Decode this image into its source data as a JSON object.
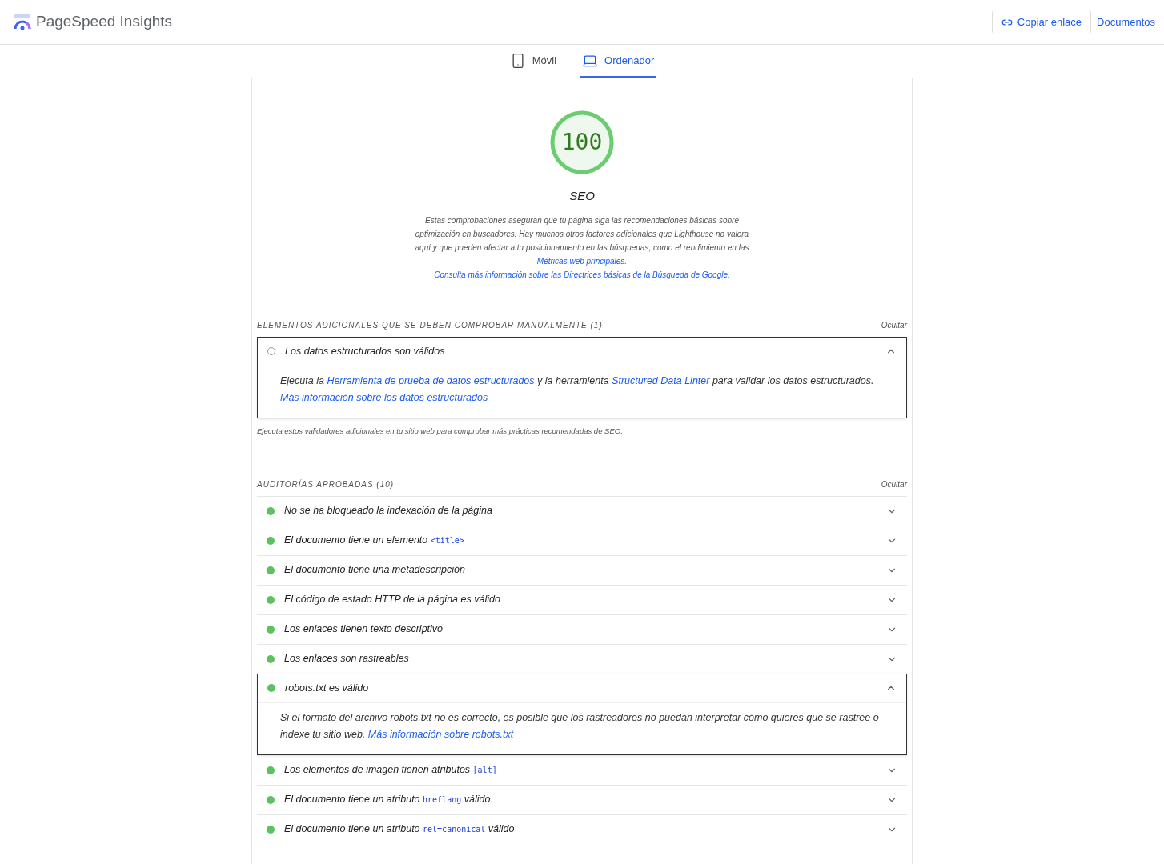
{
  "header": {
    "title": "PageSpeed Insights",
    "copy_button": "Copiar enlace",
    "docs_link": "Documentos"
  },
  "tabs": [
    {
      "label": "Móvil",
      "kind": "phone",
      "selected": false
    },
    {
      "label": "Ordenador",
      "kind": "laptop",
      "selected": true
    }
  ],
  "score": {
    "value": "100",
    "level": 1,
    "category": "SEO",
    "description": [
      {
        "kind": "text",
        "text": "Estas comprobaciones aseguran que tu página siga las recomendaciones básicas sobre optimización en buscadores. Hay muchos otros factores adicionales que Lighthouse no valora aquí y que pueden afectar a tu posicionamiento en las búsquedas, como el rendimiento en las "
      },
      {
        "kind": "link",
        "text": "Métricas web principales"
      },
      {
        "kind": "text",
        "text": ". "
      },
      {
        "kind": "link",
        "text": "Consulta más información sobre las Directrices básicas de la Búsqueda de Google"
      },
      {
        "kind": "text",
        "text": "."
      }
    ]
  },
  "sections": [
    {
      "title": "ELEMENTOS ADICIONALES QUE SE DEBEN COMPROBAR MANUALMENTE (1)",
      "toggle": "Ocultar",
      "audits": [
        {
          "kind": "manual",
          "expanded": true,
          "title": [
            {
              "kind": "text",
              "text": "Los datos estructurados son válidos"
            }
          ],
          "body": [
            {
              "kind": "text",
              "text": "Ejecuta la "
            },
            {
              "kind": "link",
              "text": "Herramienta de prueba de datos estructurados"
            },
            {
              "kind": "text",
              "text": " y la herramienta "
            },
            {
              "kind": "link",
              "text": "Structured Data Linter"
            },
            {
              "kind": "text",
              "text": " para validar los datos estructurados. "
            },
            {
              "kind": "link",
              "text": "Más información sobre los datos estructurados"
            }
          ]
        }
      ],
      "note": "Ejecuta estos validadores adicionales en tu sitio web para comprobar más prácticas recomendadas de SEO."
    },
    {
      "title": "AUDITORÍAS APROBADAS (10)",
      "toggle": "Ocultar",
      "audits": [
        {
          "kind": "pass",
          "expanded": false,
          "title": [
            {
              "kind": "text",
              "text": "No se ha bloqueado la indexación de la página"
            }
          ]
        },
        {
          "kind": "pass",
          "expanded": false,
          "title": [
            {
              "kind": "text",
              "text": "El documento tiene un elemento "
            },
            {
              "kind": "code",
              "text": "<title>"
            }
          ]
        },
        {
          "kind": "pass",
          "expanded": false,
          "title": [
            {
              "kind": "text",
              "text": "El documento tiene una metadescripción"
            }
          ]
        },
        {
          "kind": "pass",
          "expanded": false,
          "title": [
            {
              "kind": "text",
              "text": "El código de estado HTTP de la página es válido"
            }
          ]
        },
        {
          "kind": "pass",
          "expanded": false,
          "title": [
            {
              "kind": "text",
              "text": "Los enlaces tienen texto descriptivo"
            }
          ]
        },
        {
          "kind": "pass",
          "expanded": false,
          "title": [
            {
              "kind": "text",
              "text": "Los enlaces son rastreables"
            }
          ]
        },
        {
          "kind": "pass",
          "expanded": true,
          "title": [
            {
              "kind": "text",
              "text": "robots.txt es válido"
            }
          ],
          "body": [
            {
              "kind": "text",
              "text": "Si el formato del archivo robots.txt no es correcto, es posible que los rastreadores no puedan interpretar cómo quieres que se rastree o indexe tu sitio web. "
            },
            {
              "kind": "link",
              "text": "Más información sobre robots.txt"
            }
          ]
        },
        {
          "kind": "pass",
          "expanded": false,
          "title": [
            {
              "kind": "text",
              "text": "Los elementos de imagen tienen atributos "
            },
            {
              "kind": "code",
              "text": "[alt]"
            }
          ]
        },
        {
          "kind": "pass",
          "expanded": false,
          "title": [
            {
              "kind": "text",
              "text": "El documento tiene un atributo "
            },
            {
              "kind": "code",
              "text": "hreflang"
            },
            {
              "kind": "text",
              "text": " válido"
            }
          ]
        },
        {
          "kind": "pass",
          "expanded": false,
          "title": [
            {
              "kind": "text",
              "text": "El documento tiene un atributo "
            },
            {
              "kind": "code",
              "text": "rel=canonical"
            },
            {
              "kind": "text",
              "text": " válido"
            }
          ]
        }
      ]
    }
  ]
}
